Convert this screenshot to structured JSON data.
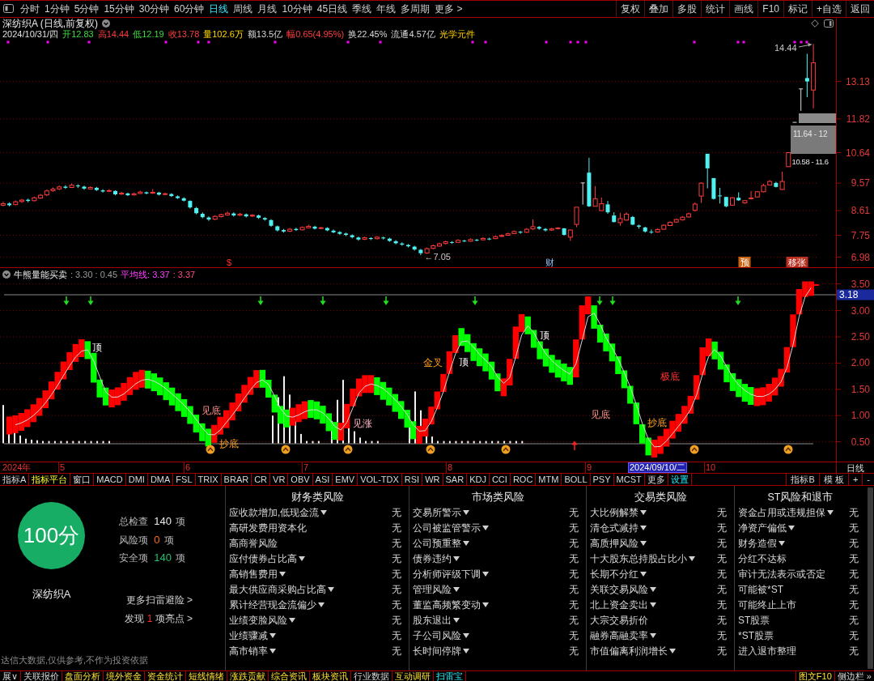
{
  "toolbar": {
    "periods": [
      {
        "label": "分时",
        "selected": false
      },
      {
        "label": "1分钟",
        "selected": false
      },
      {
        "label": "5分钟",
        "selected": false
      },
      {
        "label": "15分钟",
        "selected": false
      },
      {
        "label": "30分钟",
        "selected": false
      },
      {
        "label": "60分钟",
        "selected": false
      },
      {
        "label": "日线",
        "selected": true
      },
      {
        "label": "周线",
        "selected": false
      },
      {
        "label": "月线",
        "selected": false
      },
      {
        "label": "10分钟",
        "selected": false
      },
      {
        "label": "45日线",
        "selected": false
      },
      {
        "label": "季线",
        "selected": false
      },
      {
        "label": "年线",
        "selected": false
      },
      {
        "label": "多周期",
        "selected": false
      },
      {
        "label": "更多 >",
        "selected": false
      }
    ],
    "actions": [
      "复权",
      "叠加",
      "多股",
      "统计",
      "画线",
      "F10",
      "标记",
      "+自选",
      "返回"
    ]
  },
  "chart_header": {
    "title": "深纺织A (日线,前复权)",
    "quote": [
      {
        "text": "2024/10/31/四",
        "kind": "date"
      },
      {
        "text": "开12.83",
        "kind": "down"
      },
      {
        "text": "高14.44",
        "kind": "up"
      },
      {
        "text": "低12.19",
        "kind": "down"
      },
      {
        "text": "收13.78",
        "kind": "up"
      },
      {
        "text": "量102.6万",
        "kind": "volume"
      },
      {
        "text": "额13.5亿",
        "kind": "plain"
      },
      {
        "text": "幅0.65(4.95%)",
        "kind": "up"
      },
      {
        "text": "换22.45%",
        "kind": "plain"
      },
      {
        "text": "流通4.57亿",
        "kind": "plain"
      },
      {
        "text": "光学元件",
        "kind": "sector"
      }
    ]
  },
  "price_chart": {
    "chart_data": {
      "type": "candlestick",
      "grid": true,
      "ylim": [
        6.63,
        14.62
      ],
      "yticks": [
        13.13,
        11.82,
        10.64,
        9.57,
        8.61,
        7.75,
        6.98
      ],
      "categories": [
        null,
        null,
        null,
        null,
        null,
        null,
        null,
        null,
        null,
        null,
        null,
        null,
        null,
        null,
        null,
        null,
        null,
        null,
        null,
        null,
        null,
        null,
        null,
        null,
        null,
        null,
        null,
        null,
        null,
        null,
        null,
        null,
        null,
        null,
        null,
        null,
        null,
        null,
        null,
        null,
        null,
        null,
        null,
        null,
        null,
        null,
        null,
        null,
        null,
        null,
        null,
        null,
        null,
        null,
        null,
        null,
        null,
        null,
        null,
        null,
        null,
        null,
        null,
        null,
        null,
        null,
        null,
        null,
        null,
        null,
        null,
        null,
        null,
        null,
        null,
        null,
        null,
        null,
        null,
        null,
        null,
        null,
        null,
        null,
        null,
        null,
        null,
        null,
        null,
        null,
        null,
        null,
        null,
        null,
        null,
        null,
        null,
        null,
        null,
        null,
        null,
        null,
        null,
        null,
        null,
        null,
        null,
        null,
        null,
        null,
        null,
        null,
        null,
        null,
        null,
        null,
        null,
        null,
        null,
        null,
        null,
        null,
        null,
        null,
        null,
        null,
        null,
        null,
        null,
        null,
        null
      ],
      "ohlc": [
        [
          8.8,
          8.92,
          8.76,
          8.85
        ],
        [
          8.86,
          8.9,
          8.76,
          8.8
        ],
        [
          8.82,
          8.97,
          8.8,
          8.92
        ],
        [
          8.93,
          9.02,
          8.88,
          8.98
        ],
        [
          8.99,
          9.03,
          8.9,
          8.95
        ],
        [
          8.96,
          9.1,
          8.94,
          9.06
        ],
        [
          9.05,
          9.19,
          9.02,
          9.15
        ],
        [
          9.16,
          9.35,
          9.12,
          9.3
        ],
        [
          9.31,
          9.42,
          9.27,
          9.36
        ],
        [
          9.37,
          9.49,
          9.33,
          9.44
        ],
        [
          9.45,
          9.5,
          9.37,
          9.41
        ],
        [
          9.42,
          9.56,
          9.4,
          9.5
        ],
        [
          9.49,
          9.53,
          9.4,
          9.46
        ],
        [
          9.45,
          9.48,
          9.34,
          9.38
        ],
        [
          9.37,
          9.46,
          9.35,
          9.42
        ],
        [
          9.41,
          9.44,
          9.3,
          9.33
        ],
        [
          9.32,
          9.36,
          9.24,
          9.28
        ],
        [
          9.29,
          9.36,
          9.26,
          9.31
        ],
        [
          9.3,
          9.32,
          9.15,
          9.18
        ],
        [
          9.19,
          9.27,
          9.16,
          9.22
        ],
        [
          9.21,
          9.24,
          9.12,
          9.15
        ],
        [
          9.16,
          9.24,
          9.14,
          9.2
        ],
        [
          9.21,
          9.31,
          9.19,
          9.26
        ],
        [
          9.25,
          9.28,
          9.18,
          9.21
        ],
        [
          9.22,
          9.36,
          9.2,
          9.25
        ],
        [
          9.24,
          9.27,
          9.14,
          9.17
        ],
        [
          9.18,
          9.24,
          9.15,
          9.2
        ],
        [
          9.19,
          9.22,
          9.09,
          9.12
        ],
        [
          9.11,
          9.14,
          9.02,
          9.05
        ],
        [
          9.04,
          9.08,
          8.93,
          8.96
        ],
        [
          8.95,
          8.97,
          8.68,
          8.72
        ],
        [
          8.7,
          8.74,
          8.48,
          8.52
        ],
        [
          8.5,
          8.55,
          8.34,
          8.38
        ],
        [
          8.37,
          8.41,
          8.25,
          8.3
        ],
        [
          8.31,
          8.45,
          8.28,
          8.41
        ],
        [
          8.4,
          8.5,
          8.37,
          8.47
        ],
        [
          8.46,
          8.58,
          8.43,
          8.52
        ],
        [
          8.51,
          8.55,
          8.4,
          8.44
        ],
        [
          8.45,
          8.53,
          8.42,
          8.49
        ],
        [
          8.48,
          8.51,
          8.37,
          8.41
        ],
        [
          8.42,
          8.49,
          8.39,
          8.45
        ],
        [
          8.44,
          8.47,
          8.32,
          8.36
        ],
        [
          8.35,
          8.38,
          8.26,
          8.3
        ],
        [
          8.28,
          8.31,
          8.04,
          8.08
        ],
        [
          8.06,
          8.09,
          7.88,
          7.92
        ],
        [
          7.93,
          7.97,
          7.84,
          7.88
        ],
        [
          7.89,
          8.0,
          7.86,
          7.96
        ],
        [
          7.97,
          8.01,
          7.9,
          7.93
        ],
        [
          7.94,
          8.06,
          7.92,
          8.02
        ],
        [
          8.01,
          8.12,
          7.99,
          8.06
        ],
        [
          8.05,
          8.08,
          7.95,
          7.98
        ],
        [
          7.99,
          8.04,
          7.96,
          8.01
        ],
        [
          8.0,
          8.03,
          7.89,
          7.92
        ],
        [
          7.91,
          7.95,
          7.82,
          7.85
        ],
        [
          7.86,
          7.89,
          7.76,
          7.8
        ],
        [
          7.81,
          7.84,
          7.72,
          7.76
        ],
        [
          7.75,
          7.78,
          7.64,
          7.68
        ],
        [
          7.67,
          7.7,
          7.56,
          7.6
        ],
        [
          7.61,
          7.7,
          7.58,
          7.66
        ],
        [
          7.65,
          7.68,
          7.58,
          7.62
        ],
        [
          7.63,
          7.72,
          7.6,
          7.68
        ],
        [
          7.67,
          7.7,
          7.6,
          7.64
        ],
        [
          7.63,
          7.66,
          7.52,
          7.55
        ],
        [
          7.54,
          7.58,
          7.43,
          7.47
        ],
        [
          7.46,
          7.5,
          7.38,
          7.42
        ],
        [
          7.41,
          7.44,
          7.32,
          7.36
        ],
        [
          7.35,
          7.38,
          7.21,
          7.25
        ],
        [
          7.24,
          7.27,
          7.05,
          7.12
        ],
        [
          7.13,
          7.32,
          7.1,
          7.28
        ],
        [
          7.29,
          7.42,
          7.26,
          7.38
        ],
        [
          7.37,
          7.49,
          7.35,
          7.45
        ],
        [
          7.46,
          7.56,
          7.43,
          7.52
        ],
        [
          7.51,
          7.54,
          7.45,
          7.49
        ],
        [
          7.5,
          7.61,
          7.48,
          7.57
        ],
        [
          7.56,
          7.59,
          7.51,
          7.55
        ],
        [
          7.54,
          7.64,
          7.52,
          7.6
        ],
        [
          7.59,
          7.62,
          7.54,
          7.58
        ],
        [
          7.59,
          7.68,
          7.57,
          7.64
        ],
        [
          7.63,
          7.66,
          7.58,
          7.62
        ],
        [
          7.63,
          7.74,
          7.61,
          7.7
        ],
        [
          7.71,
          7.78,
          7.69,
          7.74
        ],
        [
          7.75,
          7.84,
          7.73,
          7.8
        ],
        [
          7.81,
          7.92,
          7.79,
          7.88
        ],
        [
          7.87,
          7.9,
          7.8,
          7.84
        ],
        [
          7.85,
          8.0,
          7.83,
          7.96
        ],
        [
          7.97,
          8.3,
          7.94,
          8.05
        ],
        [
          8.04,
          8.07,
          7.94,
          7.98
        ],
        [
          7.97,
          8.0,
          7.88,
          7.92
        ],
        [
          7.93,
          8.01,
          7.9,
          7.97
        ],
        [
          7.98,
          8.03,
          7.95,
          8.0
        ],
        [
          7.99,
          8.0,
          7.74,
          7.76
        ],
        [
          7.68,
          7.95,
          7.55,
          7.93
        ],
        [
          8.13,
          8.73,
          8.03,
          8.73
        ],
        [
          9.58,
          9.58,
          8.82,
          9.58
        ],
        [
          9.94,
          10.46,
          8.74,
          8.76
        ],
        [
          8.76,
          9.47,
          8.76,
          9.02
        ],
        [
          8.61,
          9.07,
          8.6,
          8.85
        ],
        [
          8.83,
          8.95,
          8.5,
          8.55
        ],
        [
          8.44,
          8.55,
          8.2,
          8.21
        ],
        [
          8.19,
          8.53,
          8.08,
          8.33
        ],
        [
          8.28,
          8.55,
          8.26,
          8.49
        ],
        [
          8.39,
          8.42,
          8.1,
          8.12
        ],
        [
          8.09,
          8.12,
          7.98,
          8.05
        ],
        [
          8.02,
          8.05,
          7.84,
          7.88
        ],
        [
          7.87,
          7.95,
          7.8,
          7.85
        ],
        [
          7.86,
          7.99,
          7.84,
          7.95
        ],
        [
          7.96,
          8.13,
          7.94,
          8.1
        ],
        [
          8.09,
          8.24,
          8.07,
          8.2
        ],
        [
          8.21,
          8.33,
          8.18,
          8.3
        ],
        [
          8.29,
          8.42,
          8.26,
          8.38
        ],
        [
          8.39,
          8.54,
          8.36,
          8.5
        ],
        [
          8.62,
          8.9,
          8.58,
          8.84
        ],
        [
          9.12,
          9.6,
          8.88,
          9.57
        ],
        [
          10.6,
          10.6,
          9.39,
          10.09
        ],
        [
          9.75,
          9.75,
          9.0,
          9.02
        ],
        [
          9.14,
          9.41,
          8.86,
          9.12
        ],
        [
          9.09,
          9.09,
          8.72,
          8.76
        ],
        [
          8.8,
          9.08,
          8.78,
          9.06
        ],
        [
          9.06,
          9.25,
          8.95,
          8.97
        ],
        [
          8.88,
          8.98,
          8.85,
          8.96
        ],
        [
          9.03,
          9.3,
          9.0,
          9.05
        ],
        [
          9.09,
          9.3,
          9.08,
          9.27
        ],
        [
          9.27,
          9.55,
          9.25,
          9.49
        ],
        [
          9.51,
          9.68,
          9.5,
          9.63
        ],
        [
          9.58,
          9.62,
          9.42,
          9.44
        ],
        [
          9.35,
          9.97,
          9.33,
          9.63
        ],
        [
          10.15,
          10.64,
          10.15,
          10.64
        ],
        [
          11.7,
          11.7,
          11.7,
          11.7
        ],
        [
          12.87,
          12.87,
          12.1,
          12.87
        ],
        [
          13.25,
          14.1,
          12.58,
          13.13
        ],
        [
          12.83,
          14.44,
          12.19,
          13.78
        ]
      ]
    },
    "high_label": "14.44",
    "low_label": "←7.05",
    "gap_labels": [
      "11.64 - 12",
      "10.58 - 11.6"
    ],
    "event_marks": [
      {
        "text": "$",
        "kind": "dividend"
      },
      {
        "text": "财",
        "kind": "report"
      },
      {
        "text": "预",
        "kind": "forecast"
      },
      {
        "text": "移张",
        "kind": "limit"
      }
    ]
  },
  "indicator": {
    "header": [
      {
        "text": "牛熊量能买卖",
        "kind": "name"
      },
      {
        "text": ": 3.30 : 0.45",
        "kind": "value"
      },
      {
        "text": "平均线: 3.37",
        "kind": "average"
      },
      {
        "text": ": 3.37",
        "kind": "average_value"
      }
    ],
    "axis_labels": [
      {
        "text": "3.50",
        "kind": "tick"
      },
      {
        "text": "3.18",
        "kind": "current"
      },
      {
        "text": "3.00",
        "kind": "tick"
      },
      {
        "text": "2.50",
        "kind": "tick"
      },
      {
        "text": "2.00",
        "kind": "tick"
      },
      {
        "text": "1.50",
        "kind": "tick"
      },
      {
        "text": "1.00",
        "kind": "tick"
      },
      {
        "text": "0.50",
        "kind": "tick"
      }
    ],
    "signals": [
      {
        "text": "顶",
        "kind": "top"
      },
      {
        "text": "见底",
        "kind": "bottom"
      },
      {
        "text": "抄底",
        "kind": "buy"
      },
      {
        "text": "见涨",
        "kind": "rise"
      },
      {
        "text": "金叉",
        "kind": "cross"
      },
      {
        "text": "顶",
        "kind": "top"
      },
      {
        "text": "顶",
        "kind": "top"
      },
      {
        "text": "见底",
        "kind": "bottom"
      },
      {
        "text": "极底",
        "kind": "extreme"
      },
      {
        "text": "抄底",
        "kind": "buy"
      }
    ]
  },
  "date_axis": {
    "labels": [
      {
        "text": "2024年",
        "kind": "year"
      },
      {
        "text": "5",
        "kind": "month"
      },
      {
        "text": "6",
        "kind": "month"
      },
      {
        "text": "7",
        "kind": "month"
      },
      {
        "text": "8",
        "kind": "month"
      },
      {
        "text": "9",
        "kind": "month"
      },
      {
        "text": "2024/09/10/二",
        "kind": "cursor"
      },
      {
        "text": "10",
        "kind": "month"
      }
    ],
    "period": "日线"
  },
  "indicator_tabs": {
    "tabs": [
      {
        "label": "指标A",
        "kind": "plain",
        "selected": false
      },
      {
        "label": "指标平台",
        "kind": "feature",
        "selected": false
      },
      {
        "label": "窗口",
        "kind": "plain",
        "selected": false
      },
      {
        "label": "MACD",
        "kind": "plain",
        "selected": false
      },
      {
        "label": "DMI",
        "kind": "plain",
        "selected": false
      },
      {
        "label": "DMA",
        "kind": "plain",
        "selected": false
      },
      {
        "label": "FSL",
        "kind": "plain",
        "selected": false
      },
      {
        "label": "TRIX",
        "kind": "plain",
        "selected": false
      },
      {
        "label": "BRAR",
        "kind": "plain",
        "selected": false
      },
      {
        "label": "CR",
        "kind": "plain",
        "selected": false
      },
      {
        "label": "VR",
        "kind": "plain",
        "selected": false
      },
      {
        "label": "OBV",
        "kind": "plain",
        "selected": false
      },
      {
        "label": "ASI",
        "kind": "plain",
        "selected": false
      },
      {
        "label": "EMV",
        "kind": "plain",
        "selected": false
      },
      {
        "label": "VOL-TDX",
        "kind": "plain",
        "selected": false
      },
      {
        "label": "RSI",
        "kind": "plain",
        "selected": false
      },
      {
        "label": "WR",
        "kind": "plain",
        "selected": false
      },
      {
        "label": "SAR",
        "kind": "plain",
        "selected": false
      },
      {
        "label": "KDJ",
        "kind": "plain",
        "selected": false
      },
      {
        "label": "CCI",
        "kind": "plain",
        "selected": false
      },
      {
        "label": "ROC",
        "kind": "plain",
        "selected": false
      },
      {
        "label": "MTM",
        "kind": "plain",
        "selected": false
      },
      {
        "label": "BOLL",
        "kind": "plain",
        "selected": false
      },
      {
        "label": "PSY",
        "kind": "plain",
        "selected": false
      },
      {
        "label": "MCST",
        "kind": "plain",
        "selected": false
      },
      {
        "label": "更多",
        "kind": "plain",
        "selected": false
      },
      {
        "label": "设置",
        "kind": "plain",
        "selected": true
      }
    ],
    "right": [
      "指标B",
      "模 板",
      "+",
      "-"
    ]
  },
  "risk_panel": {
    "score": "100分",
    "stock": "深纺织A",
    "summary": [
      {
        "label": "总检查",
        "count": "140",
        "unit": "项",
        "kind": "total"
      },
      {
        "label": "风险项",
        "count": "0",
        "unit": "项",
        "kind": "risk"
      },
      {
        "label": "安全项",
        "count": "140",
        "unit": "项",
        "kind": "safe"
      }
    ],
    "more_link": "更多扫雷避险 >",
    "highlight_link": {
      "prefix": "发现",
      "count": "1",
      "suffix": "项亮点 >"
    },
    "disclaimer": "达信大数据,仅供参考,不作为投资依据",
    "categories": [
      {
        "title": "财务类风险",
        "items": [
          {
            "label": "应收款增加,低现金流",
            "expandable": true,
            "result": "无"
          },
          {
            "label": "高研发费用资本化",
            "expandable": false,
            "result": "无"
          },
          {
            "label": "高商誉风险",
            "expandable": false,
            "result": "无"
          },
          {
            "label": "应付债券占比高",
            "expandable": true,
            "result": "无"
          },
          {
            "label": "高销售费用",
            "expandable": true,
            "result": "无"
          },
          {
            "label": "最大供应商采购占比高",
            "expandable": true,
            "result": "无"
          },
          {
            "label": "累计经营现金流偏少",
            "expandable": true,
            "result": "无"
          },
          {
            "label": "业绩变脸风险",
            "expandable": true,
            "result": "无"
          },
          {
            "label": "业绩骤减",
            "expandable": true,
            "result": "无"
          },
          {
            "label": "高市销率",
            "expandable": true,
            "result": "无"
          }
        ]
      },
      {
        "title": "市场类风险",
        "items": [
          {
            "label": "交易所警示",
            "expandable": true,
            "result": "无"
          },
          {
            "label": "公司被监管警示",
            "expandable": true,
            "result": "无"
          },
          {
            "label": "公司预重整",
            "expandable": true,
            "result": "无"
          },
          {
            "label": "债券违约",
            "expandable": true,
            "result": "无"
          },
          {
            "label": "分析师评级下调",
            "expandable": true,
            "result": "无"
          },
          {
            "label": "管理风险",
            "expandable": true,
            "result": "无"
          },
          {
            "label": "董监高频繁变动",
            "expandable": true,
            "result": "无"
          },
          {
            "label": "股东退出",
            "expandable": true,
            "result": "无"
          },
          {
            "label": "子公司风险",
            "expandable": true,
            "result": "无"
          },
          {
            "label": "长时间停牌",
            "expandable": true,
            "result": "无"
          }
        ]
      },
      {
        "title": "交易类风险",
        "items": [
          {
            "label": "大比例解禁",
            "expandable": true,
            "result": "无"
          },
          {
            "label": "清仓式减持",
            "expandable": true,
            "result": "无"
          },
          {
            "label": "高质押风险",
            "expandable": true,
            "result": "无"
          },
          {
            "label": "十大股东总持股占比小",
            "expandable": true,
            "result": "无"
          },
          {
            "label": "长期不分红",
            "expandable": true,
            "result": "无"
          },
          {
            "label": "关联交易风险",
            "expandable": true,
            "result": "无"
          },
          {
            "label": "北上资金卖出",
            "expandable": true,
            "result": "无"
          },
          {
            "label": "大宗交易折价",
            "expandable": false,
            "result": "无"
          },
          {
            "label": "融券高融卖率",
            "expandable": true,
            "result": "无"
          },
          {
            "label": "市值偏离利润增长",
            "expandable": true,
            "result": "无"
          }
        ]
      },
      {
        "title": "ST风险和退市",
        "items": [
          {
            "label": "资金占用或违规担保",
            "expandable": true,
            "result": "无"
          },
          {
            "label": "净资产偏低",
            "expandable": true,
            "result": "无"
          },
          {
            "label": "财务造假",
            "expandable": true,
            "result": "无"
          },
          {
            "label": "分红不达标",
            "expandable": false,
            "result": "无"
          },
          {
            "label": "审计无法表示或否定",
            "expandable": false,
            "result": "无"
          },
          {
            "label": "可能被*ST",
            "expandable": false,
            "result": "无"
          },
          {
            "label": "可能终止上市",
            "expandable": false,
            "result": "无"
          },
          {
            "label": "ST股票",
            "expandable": false,
            "result": "无"
          },
          {
            "label": "*ST股票",
            "expandable": false,
            "result": "无"
          },
          {
            "label": "进入退市整理",
            "expandable": false,
            "result": "无"
          }
        ]
      }
    ]
  },
  "bottom_tabs": {
    "tabs": [
      {
        "label": "展∨",
        "kind": "plain",
        "selected": false
      },
      {
        "label": "关联报价",
        "kind": "plain",
        "selected": false
      },
      {
        "label": "盘面分析",
        "kind": "feature",
        "selected": false
      },
      {
        "label": "境外资金",
        "kind": "feature",
        "selected": false
      },
      {
        "label": "资金统计",
        "kind": "feature",
        "selected": false
      },
      {
        "label": "短线情绪",
        "kind": "feature",
        "selected": false
      },
      {
        "label": "涨跌贡献",
        "kind": "feature",
        "selected": false
      },
      {
        "label": "综合资讯",
        "kind": "feature",
        "selected": false
      },
      {
        "label": "板块资讯",
        "kind": "feature",
        "selected": false
      },
      {
        "label": "行业数据",
        "kind": "plain",
        "selected": false
      },
      {
        "label": "互动调研",
        "kind": "feature",
        "selected": false
      },
      {
        "label": "扫雷宝",
        "kind": "plain",
        "selected": true
      }
    ],
    "right": [
      {
        "label": "图文F10",
        "kind": "feature"
      },
      {
        "label": "侧边栏 »",
        "kind": "plain"
      }
    ]
  }
}
